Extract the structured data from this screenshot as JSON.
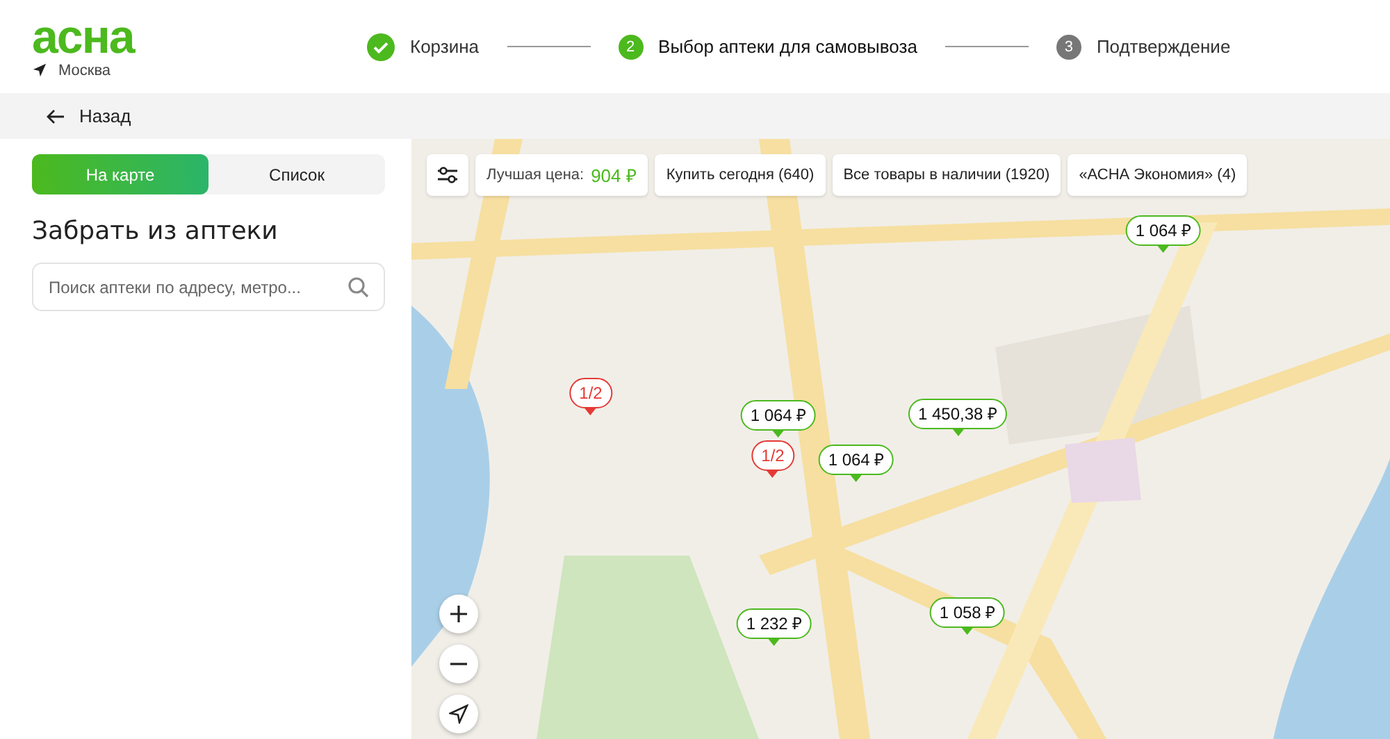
{
  "header": {
    "logo": "асна",
    "city": "Москва"
  },
  "steps": [
    {
      "label": "Корзина",
      "completed": true,
      "selected": false
    },
    {
      "label": "Выбор аптеки для самовывоза",
      "completed": false,
      "selected": true,
      "number": "2"
    },
    {
      "label": "Подтверждение",
      "completed": false,
      "selected": false,
      "number": "3"
    }
  ],
  "back": {
    "label": "Назад"
  },
  "view_tabs": [
    {
      "label": "На карте",
      "selected": true
    },
    {
      "label": "Список",
      "selected": false
    }
  ],
  "panel_title": "Забрать из аптеки",
  "search": {
    "placeholder": "Поиск аптеки по адресу, метро..."
  },
  "filters": [
    {
      "label": "Лучшая цена:",
      "value": "904 ₽"
    },
    {
      "label": "Купить сегодня (640)"
    },
    {
      "label": "Все товары в наличии (1920)"
    },
    {
      "label": "«АСНА Экономия» (4)"
    }
  ],
  "map": {
    "markers": [
      {
        "kind": "price",
        "text": "1 064 ₽"
      },
      {
        "kind": "partial",
        "text": "1/2"
      },
      {
        "kind": "price",
        "text": "1 064 ₽"
      },
      {
        "kind": "partial",
        "text": "1/2"
      },
      {
        "kind": "price",
        "text": "1 450,38 ₽"
      },
      {
        "kind": "price",
        "text": "1 064 ₽"
      },
      {
        "kind": "price",
        "text": "1 058 ₽"
      },
      {
        "kind": "price",
        "text": "1 232 ₽"
      }
    ]
  }
}
